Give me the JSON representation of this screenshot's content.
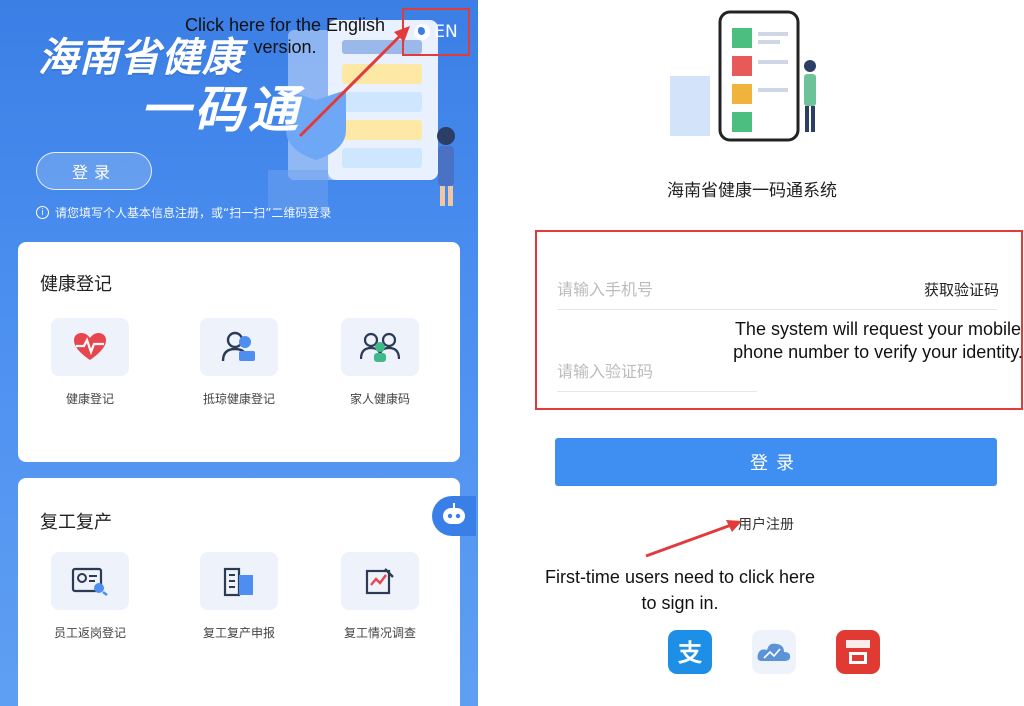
{
  "left": {
    "hero_title": "海南省健康",
    "hero_subtitle": "一码通",
    "lang_toggle": "EN",
    "login_label": "登录",
    "hint": "请您填写个人基本信息注册，或“扫一扫”二维码登录",
    "hint_icon": "info-icon",
    "cards": [
      {
        "title": "健康登记",
        "items": [
          {
            "label": "健康登记",
            "icon": "heart-pulse-icon"
          },
          {
            "label": "抵琼健康登记",
            "icon": "traveler-icon"
          },
          {
            "label": "家人健康码",
            "icon": "family-icon"
          }
        ]
      },
      {
        "title": "复工复产",
        "items": [
          {
            "label": "员工返岗登记",
            "icon": "id-card-search-icon"
          },
          {
            "label": "复工复产申报",
            "icon": "building-icon"
          },
          {
            "label": "复工情况调查",
            "icon": "survey-icon"
          }
        ]
      }
    ]
  },
  "right": {
    "system_title": "海南省健康一码通系统",
    "phone_placeholder": "请输入手机号",
    "get_code": "获取验证码",
    "code_placeholder": "请输入验证码",
    "login_button": "登录",
    "register_link": "用户注册",
    "app_icons": [
      "alipay-icon",
      "cloud-app-icon",
      "payment-app-icon"
    ]
  },
  "annotations": {
    "english_version": "Click here for the English version.",
    "verify": "The system will request your mobile phone number to verify your identity.",
    "sign_in": "First-time users need to click here to sign in."
  },
  "colors": {
    "primary_blue": "#3f8ef2",
    "highlight_red": "#e23b3b"
  }
}
